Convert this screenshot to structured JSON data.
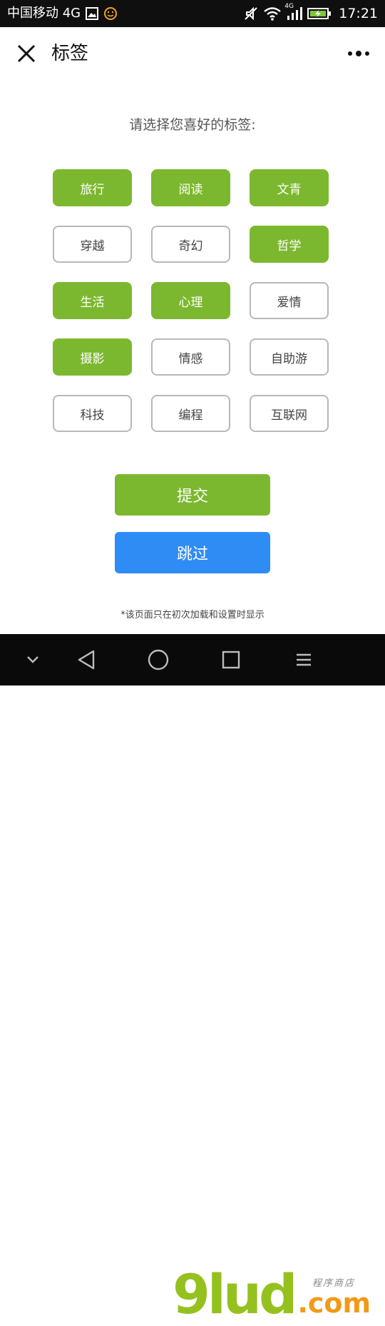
{
  "status_bar": {
    "carrier": "中国移动 4G",
    "network_small": "4G",
    "time": "17:21",
    "icons": [
      "gallery-icon",
      "smiley-icon",
      "mute-icon",
      "wifi-icon",
      "signal-icon",
      "battery-charging-icon"
    ]
  },
  "header": {
    "title": "标签",
    "close_icon": "close-icon",
    "more_icon": "more-icon"
  },
  "prompt": "请选择您喜好的标签:",
  "tags": [
    {
      "label": "旅行",
      "selected": true
    },
    {
      "label": "阅读",
      "selected": true
    },
    {
      "label": "文青",
      "selected": true
    },
    {
      "label": "穿越",
      "selected": false
    },
    {
      "label": "奇幻",
      "selected": false
    },
    {
      "label": "哲学",
      "selected": true
    },
    {
      "label": "生活",
      "selected": true
    },
    {
      "label": "心理",
      "selected": true
    },
    {
      "label": "爱情",
      "selected": false
    },
    {
      "label": "摄影",
      "selected": true
    },
    {
      "label": "情感",
      "selected": false
    },
    {
      "label": "自助游",
      "selected": false
    },
    {
      "label": "科技",
      "selected": false
    },
    {
      "label": "编程",
      "selected": false
    },
    {
      "label": "互联网",
      "selected": false
    }
  ],
  "buttons": {
    "submit": "提交",
    "skip": "跳过"
  },
  "note": "*该页面只在初次加载和设置时显示",
  "colors": {
    "accent_green": "#7cb82f",
    "accent_blue": "#2f8cf4",
    "border_gray": "#b8b8b8"
  },
  "watermark": {
    "main": "9lud",
    "suffix": ".com",
    "small": "程序商店"
  }
}
